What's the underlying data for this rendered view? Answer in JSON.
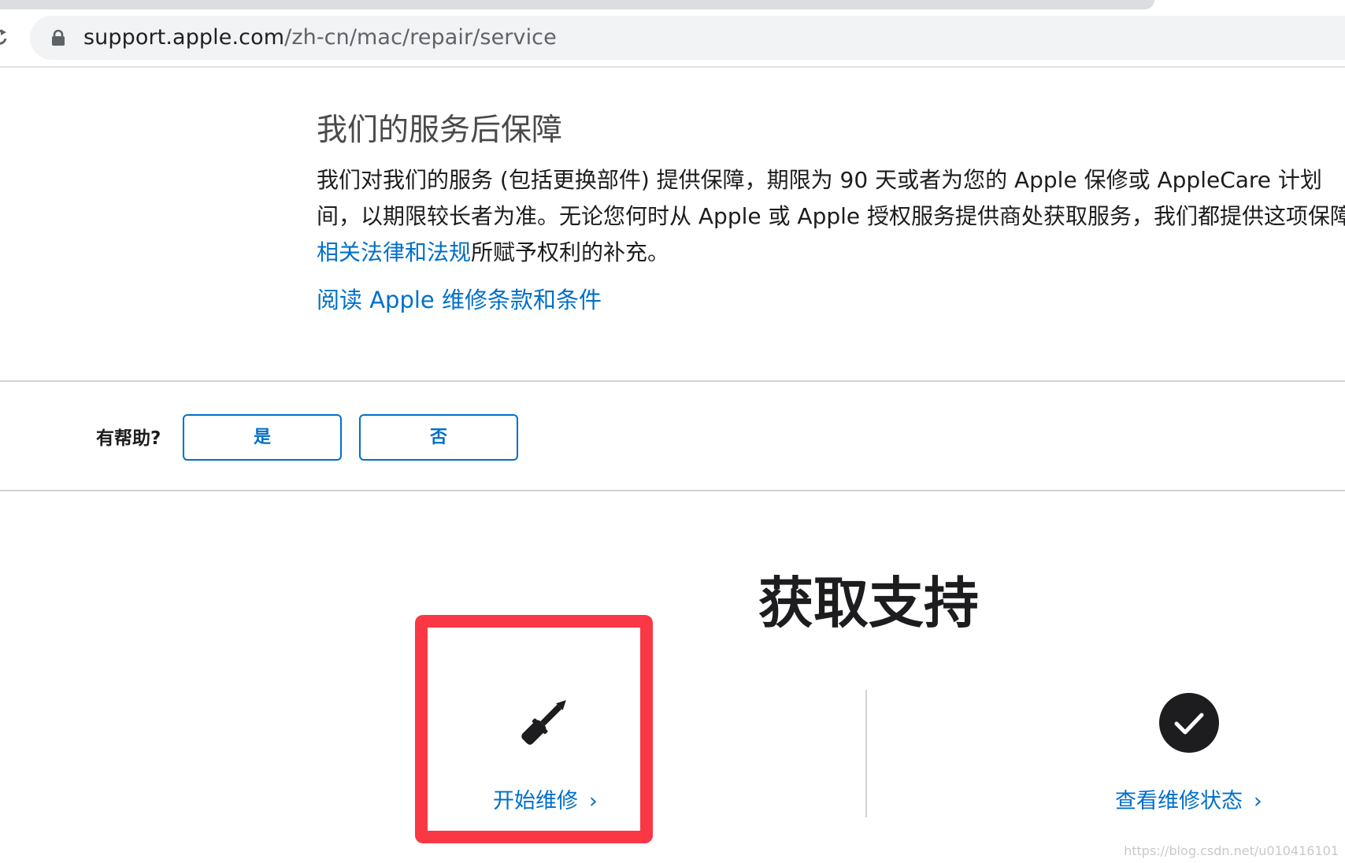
{
  "browser": {
    "url_host": "support.apple.com",
    "url_path": "/zh-cn/mac/repair/service",
    "icons": [
      "reload-icon",
      "lock-icon"
    ]
  },
  "warranty": {
    "title": "我们的服务后保障",
    "para_line1": "我们对我们的服务 (包括更换部件) 提供保障，期限为 90 天或者为您的 Apple 保修或 AppleCare 计划",
    "para_line2": "间，以期限较长者为准。无论您何时从 Apple 或 Apple 授权服务提供商处获取服务，我们都提供这项保障",
    "para_link": "相关法律和法规",
    "para_line3_rest": "所赋予权利的补充。",
    "terms_link": "阅读 Apple 维修条款和条件"
  },
  "feedback": {
    "label": "有帮助?",
    "yes_label": "是",
    "no_label": "否"
  },
  "support": {
    "title": "获取支持",
    "start_repair": {
      "label": "开始维修",
      "chevron": "›",
      "icon": "screwdriver-icon"
    },
    "repair_status": {
      "label": "查看维修状态",
      "chevron": "›",
      "icon": "checkmark-circle-icon"
    }
  },
  "watermark": "https://blog.csdn.net/u010416101",
  "colors": {
    "link": "#0070c9",
    "highlight": "#fa3744",
    "divider": "#d2d2d7"
  }
}
